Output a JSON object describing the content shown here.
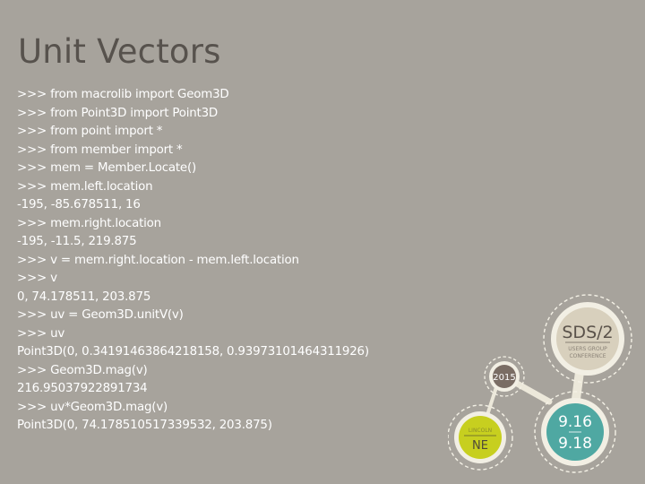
{
  "slide": {
    "title": "Unit Vectors",
    "code_lines": [
      ">>> from macrolib import Geom3D",
      ">>> from Point3D import Point3D",
      ">>> from point import *",
      ">>> from member import *",
      ">>> mem = Member.Locate()",
      ">>> mem.left.location",
      "-195, -85.678511, 16",
      ">>> mem.right.location",
      "-195, -11.5, 219.875",
      ">>> v = mem.right.location - mem.left.location",
      ">>> v",
      "0, 74.178511, 203.875",
      ">>> uv = Geom3D.unitV(v)",
      ">>> uv",
      "Point3D(0, 0.34191463864218158, 0.93973101464311926)",
      ">>> Geom3D.mag(v)",
      "216.95037922891734",
      ">>> uv*Geom3D.mag(v)",
      "Point3D(0, 74.178510517339532, 203.875)"
    ]
  },
  "logo": {
    "main_text": "SDS/2",
    "sub_line1": "USERS GROUP",
    "sub_line2": "CONFERENCE",
    "year": "2015",
    "date_start": "9.16",
    "date_end": "9.18",
    "city": "LINCOLN",
    "state": "NE",
    "colors": {
      "sds_fill": "#d8d0bd",
      "year_fill": "#7a6d64",
      "date_fill": "#4fa8a2",
      "city_fill": "#c7cf1f",
      "ring": "#f2efe4"
    }
  }
}
